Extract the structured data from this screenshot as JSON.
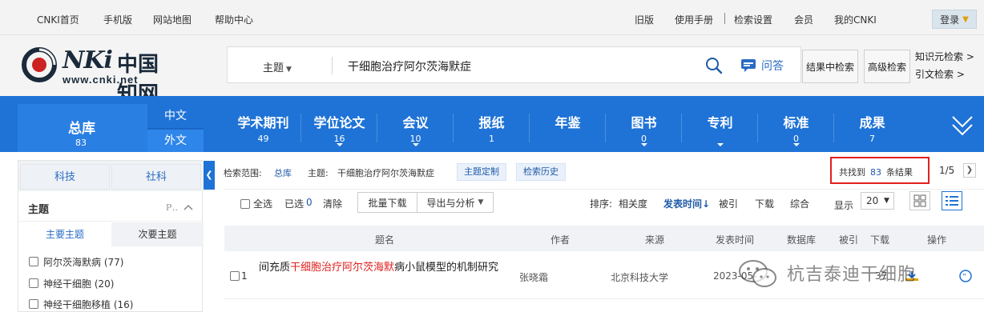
{
  "topbar": {
    "left_links": [
      "CNKI首页",
      "手机版",
      "网站地图",
      "帮助中心"
    ],
    "right_links": [
      "旧版",
      "使用手册",
      "检索设置",
      "会员",
      "我的CNKI"
    ],
    "login": "登录"
  },
  "logo": {
    "brand": "CNKi中国知网",
    "url": "www.cnki.net"
  },
  "search": {
    "field": "主题",
    "query": "干细胞治疗阿尔茨海默症",
    "ask_label": "问答"
  },
  "header_buttons": {
    "in_results": "结果中检索",
    "advanced": "高级检索",
    "knowledge": "知识元检索 >",
    "citation": "引文检索 >"
  },
  "nav": {
    "total": {
      "label": "总库",
      "count": "83"
    },
    "lang": {
      "zh": "中文",
      "en": "外文"
    },
    "items": [
      {
        "label": "学术期刊",
        "count": "49"
      },
      {
        "label": "学位论文",
        "count": "16"
      },
      {
        "label": "会议",
        "count": "10"
      },
      {
        "label": "报纸",
        "count": "1"
      },
      {
        "label": "年鉴",
        "count": ""
      },
      {
        "label": "图书",
        "count": "0"
      },
      {
        "label": "专利",
        "count": ""
      },
      {
        "label": "标准",
        "count": "0"
      },
      {
        "label": "成果",
        "count": "7"
      }
    ]
  },
  "sidebar": {
    "tabs": [
      "科技",
      "社科"
    ],
    "section": "主题",
    "subtabs": [
      "主要主题",
      "次要主题"
    ],
    "items": [
      {
        "label": "阿尔茨海默病 (77)"
      },
      {
        "label": "神经干细胞 (20)"
      },
      {
        "label": "神经干细胞移植 (16)"
      }
    ]
  },
  "scope": {
    "range_label": "检索范围:",
    "range_value": "总库",
    "topic_label": "主题:",
    "topic_value": "干细胞治疗阿尔茨海默症",
    "custom_btn": "主题定制",
    "history_btn": "检索历史",
    "found_prefix": "共找到",
    "found_count": "83",
    "found_suffix": "条结果",
    "page": "1/5"
  },
  "toolbar": {
    "select_all": "全选",
    "selected_label": "已选",
    "selected_count": "0",
    "clear": "清除",
    "batch_download": "批量下载",
    "export": "导出与分析",
    "sort_label": "排序:",
    "sort_options": [
      "相关度",
      "发表时间",
      "被引",
      "下载",
      "综合"
    ],
    "active_sort": "发表时间",
    "display_label": "显示",
    "page_size": "20"
  },
  "table": {
    "headers": [
      "题名",
      "作者",
      "来源",
      "发表时间",
      "数据库",
      "被引",
      "下载",
      "操作"
    ],
    "rows": [
      {
        "index": "1",
        "title_pre": "间充质",
        "title_hl": "干细胞治疗阿尔茨海默",
        "title_post": "病小鼠模型的机制研究",
        "author": "张晓霜",
        "source": "北京科技大学",
        "date": "2023-05-",
        "downloads": "37"
      }
    ]
  },
  "watermark": "杭吉泰迪干细胞"
}
